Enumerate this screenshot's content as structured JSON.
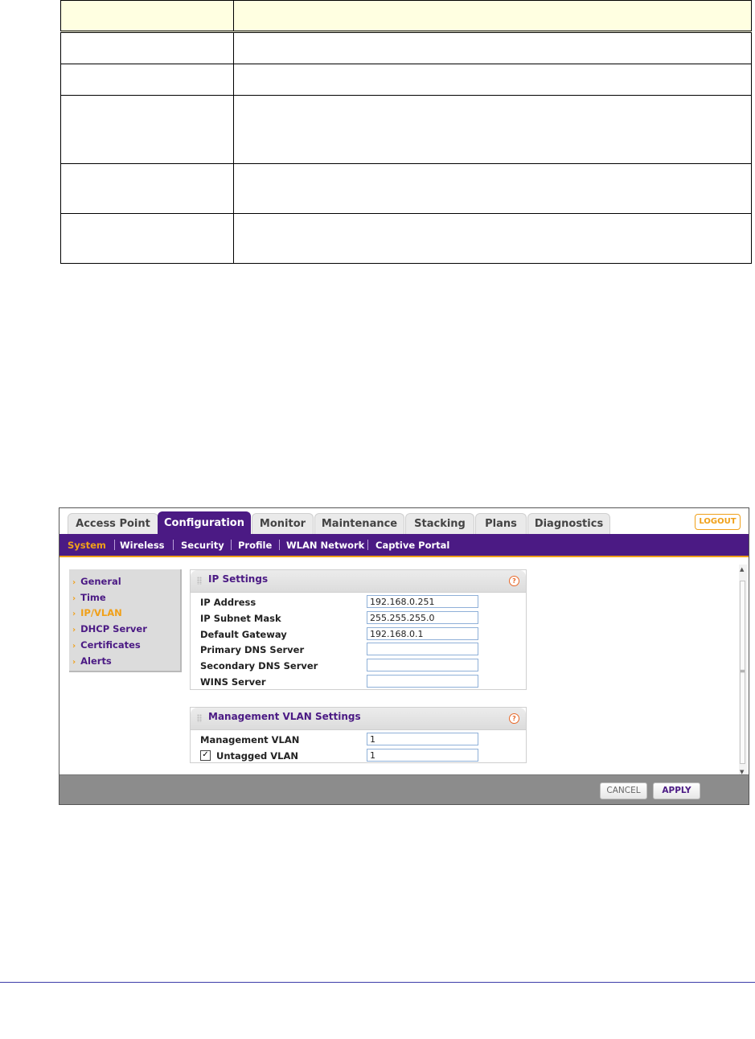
{
  "tabs": [
    {
      "label": "Access Point"
    },
    {
      "label": "Configuration"
    },
    {
      "label": "Monitor"
    },
    {
      "label": "Maintenance"
    },
    {
      "label": "Stacking"
    },
    {
      "label": "Plans"
    },
    {
      "label": "Diagnostics"
    }
  ],
  "logout_label": "LOGOUT",
  "subnav": [
    {
      "label": "System"
    },
    {
      "label": "Wireless"
    },
    {
      "label": "Security"
    },
    {
      "label": "Profile"
    },
    {
      "label": "WLAN Network"
    },
    {
      "label": "Captive Portal"
    }
  ],
  "sidebar": [
    {
      "label": "General"
    },
    {
      "label": "Time"
    },
    {
      "label": "IP/VLAN"
    },
    {
      "label": "DHCP Server"
    },
    {
      "label": "Certificates"
    },
    {
      "label": "Alerts"
    }
  ],
  "ip_settings": {
    "title": "IP Settings",
    "fields": [
      {
        "label": "IP Address",
        "value": "192.168.0.251"
      },
      {
        "label": "IP Subnet Mask",
        "value": "255.255.255.0"
      },
      {
        "label": "Default Gateway",
        "value": "192.168.0.1"
      },
      {
        "label": "Primary DNS Server",
        "value": ""
      },
      {
        "label": "Secondary DNS Server",
        "value": ""
      },
      {
        "label": "WINS Server",
        "value": ""
      }
    ]
  },
  "vlan_settings": {
    "title": "Management VLAN Settings",
    "management_vlan_label": "Management VLAN",
    "management_vlan_value": "1",
    "untagged_label": "Untagged VLAN",
    "untagged_checked_glyph": "✓",
    "untagged_value": "1"
  },
  "help_glyph": "?",
  "buttons": {
    "cancel": "CANCEL",
    "apply": "APPLY"
  },
  "colors": {
    "brand_purple": "#4b1a84",
    "accent_orange": "#f0a019"
  }
}
